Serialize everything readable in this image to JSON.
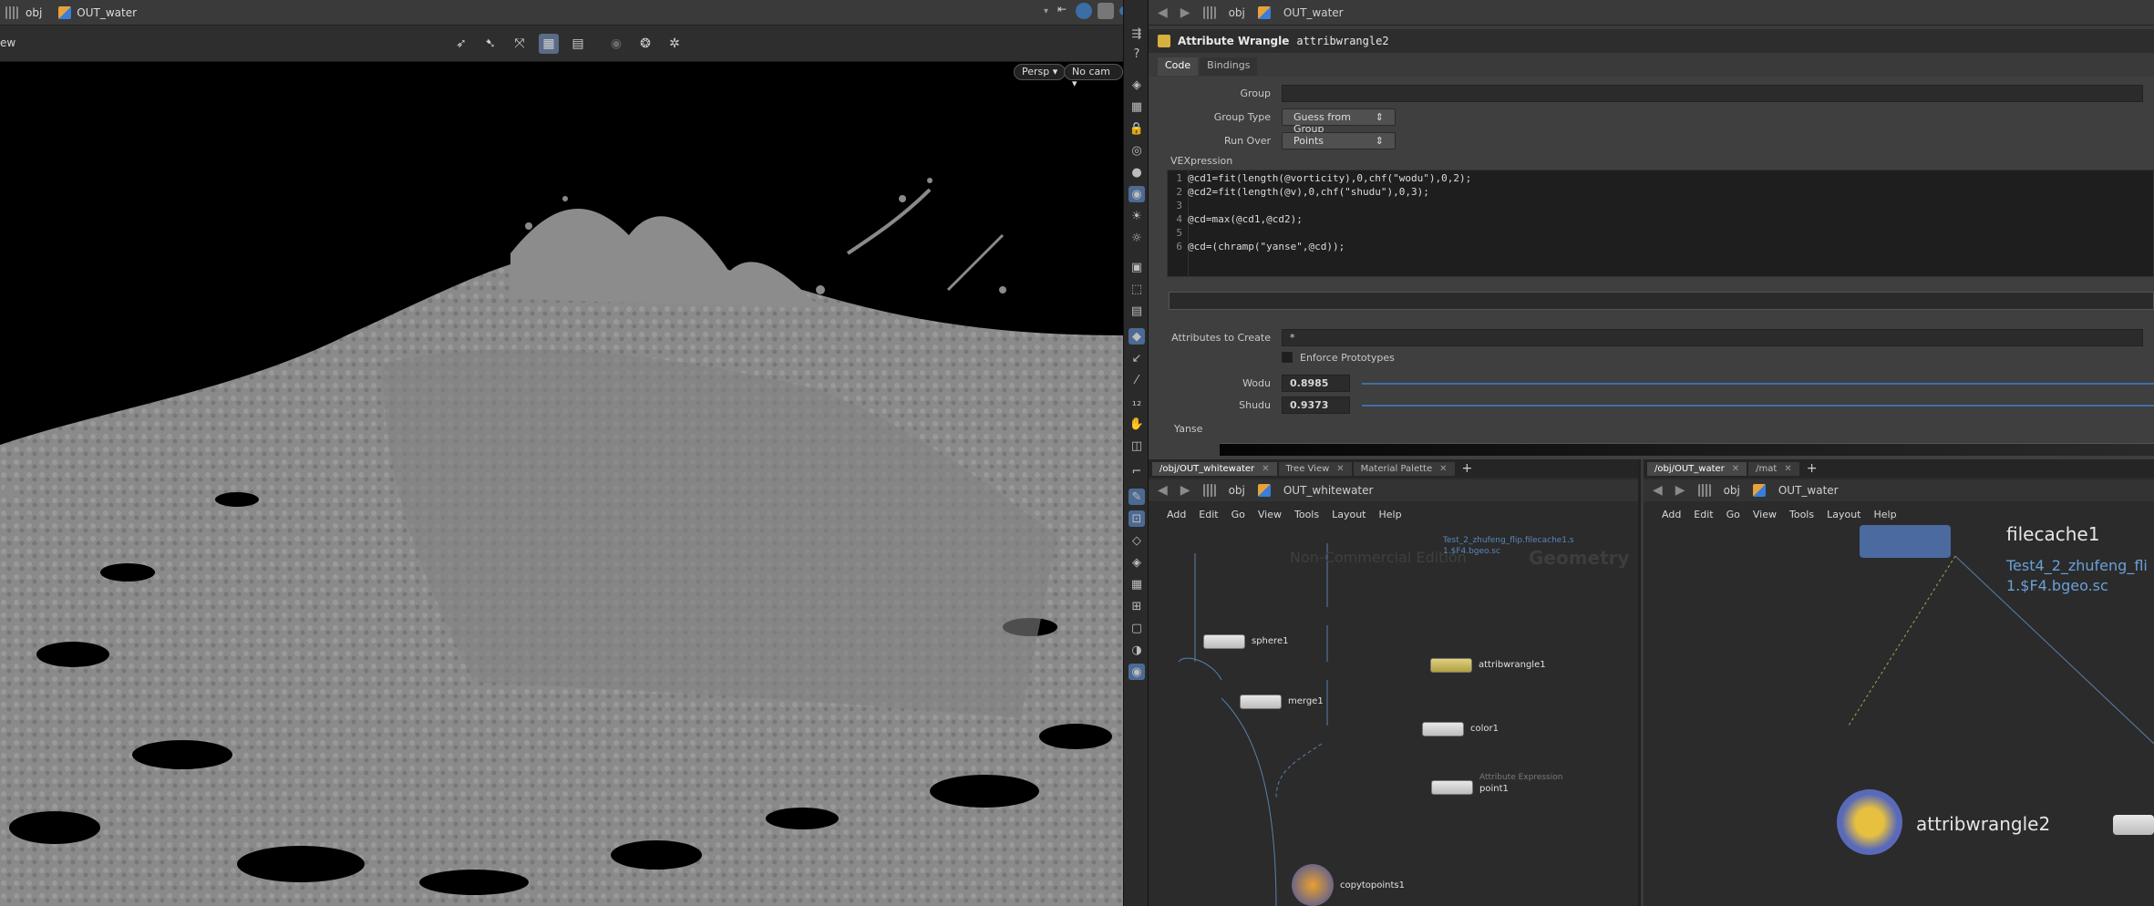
{
  "left_pane": {
    "path": [
      "obj",
      "OUT_water"
    ],
    "viewport_title": "ew",
    "persp_label": "Persp",
    "cam_label": "No cam"
  },
  "params_pane": {
    "path": [
      "obj",
      "OUT_water"
    ],
    "node_type": "Attribute Wrangle",
    "node_name": "attribwrangle2",
    "tabs": [
      "Code",
      "Bindings"
    ],
    "group_label": "Group",
    "group_value": "",
    "group_type_label": "Group Type",
    "group_type_value": "Guess from Group",
    "run_over_label": "Run Over",
    "run_over_value": "Points",
    "vex_label": "VEXpression",
    "code_lines": [
      "@cd1=fit(length(@vorticity),0,chf(\"wodu\"),0,2);",
      "@cd2=fit(length(@v),0,chf(\"shudu\"),0,3);",
      "",
      "@cd=max(@cd1,@cd2);",
      "",
      "@cd=(chramp(\"yanse\",@cd));"
    ],
    "attrs_label": "Attributes to Create",
    "attrs_value": "*",
    "enforce_label": "Enforce Prototypes",
    "wodu_label": "Wodu",
    "wodu_value": "0.8985",
    "shudu_label": "Shudu",
    "shudu_value": "0.9373",
    "yanse_label": "Yanse"
  },
  "net_left": {
    "tabs": [
      "/obj/OUT_whitewater",
      "Tree View",
      "Material Palette"
    ],
    "path": [
      "obj",
      "OUT_whitewater"
    ],
    "menu": [
      "Add",
      "Edit",
      "Go",
      "View",
      "Tools",
      "Layout",
      "Help"
    ],
    "watermark": "Non-Commercial Edition",
    "context": "Geometry",
    "top_node_sub": "Test_2_zhufeng_flip.filecache1.s",
    "top_node_sub2": "1.$F4.bgeo.sc",
    "nodes": {
      "sphere": "sphere1",
      "merge": "merge1",
      "wrangle": "attribwrangle1",
      "color": "color1",
      "point": "point1",
      "point_sub": "Attribute Expression",
      "copy": "copytopoints1"
    }
  },
  "net_right": {
    "tabs": [
      "/obj/OUT_water",
      "/mat"
    ],
    "path": [
      "obj",
      "OUT_water"
    ],
    "menu": [
      "Add",
      "Edit",
      "Go",
      "View",
      "Tools",
      "Layout",
      "Help"
    ],
    "filecache_label": "filecache1",
    "filecache_sub1": "Test4_2_zhufeng_fli",
    "filecache_sub2": "1.$F4.bgeo.sc",
    "wrangle_label": "attribwrangle2"
  }
}
